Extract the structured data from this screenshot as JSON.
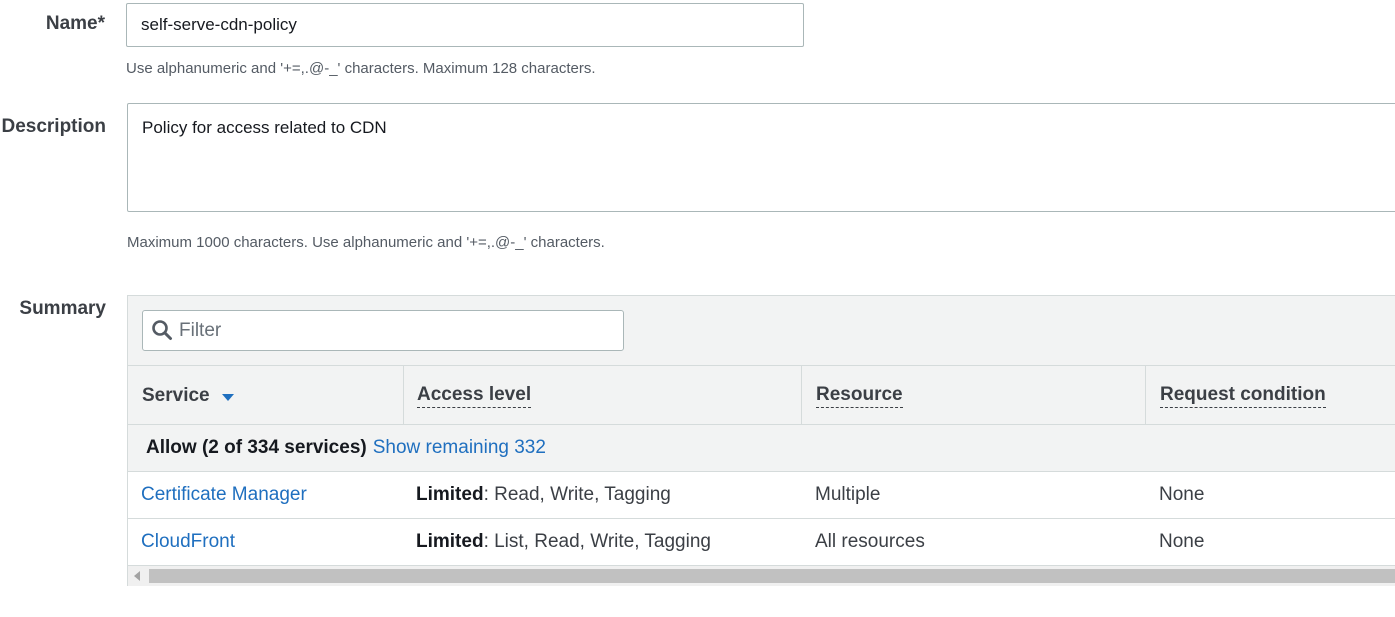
{
  "form": {
    "name_label": "Name*",
    "name_value": "self-serve-cdn-policy",
    "name_hint": "Use alphanumeric and '+=,.@-_' characters. Maximum 128 characters.",
    "description_label": "Description",
    "description_value": "Policy for access related to CDN",
    "description_hint": "Maximum 1000 characters. Use alphanumeric and '+=,.@-_' characters.",
    "summary_label": "Summary"
  },
  "summary": {
    "filter_placeholder": "Filter",
    "filter_icon": "search-icon",
    "columns": [
      "Service",
      "Access level",
      "Resource",
      "Request condition"
    ],
    "allow_text": "Allow (2 of 334 services)",
    "show_remaining": "Show remaining 332",
    "rows": [
      {
        "service": "Certificate Manager",
        "access_bold": "Limited",
        "access_rest": ": Read, Write, Tagging",
        "resource": "Multiple",
        "condition": "None"
      },
      {
        "service": "CloudFront",
        "access_bold": "Limited",
        "access_rest": ": List, Read, Write, Tagging",
        "resource": "All resources",
        "condition": "None"
      }
    ]
  },
  "colors": {
    "link": "#1f6fbf",
    "header_bg": "#f2f3f3",
    "border": "#d5dbdb"
  }
}
